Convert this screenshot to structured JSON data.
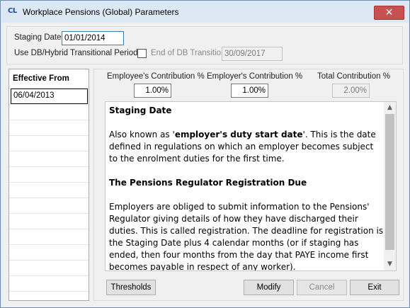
{
  "window": {
    "app_icon": "CL",
    "title": "Workplace Pensions (Global) Parameters",
    "close_glyph": "✕"
  },
  "staging": {
    "staging_date_label": "Staging Date",
    "staging_date_value": "01/01/2014",
    "transitional_label": "Use DB/Hybrid Transitional Period?",
    "transitional_checked": false,
    "end_db_label": "End of DB Transition",
    "end_db_value": "30/09/2017"
  },
  "effective": {
    "header": "Effective From",
    "selected_date": "06/04/2013"
  },
  "contributions": {
    "employee_label": "Employee's Contribution %",
    "employee_value": "1.00%",
    "employer_label": "Employer's Contribution %",
    "employer_value": "1.00%",
    "total_label": "Total Contribution %",
    "total_value": "2.00%"
  },
  "help": {
    "heading1": "Staging Date",
    "para1_prefix": "Also known as '",
    "para1_bold": "employer's duty start date",
    "para1_suffix": "'. This is the date defined in regulations on which an employer becomes subject to the enrolment duties for the first time.",
    "heading2": "The Pensions Regulator Registration Due",
    "para2": "Employers are obliged to submit information to the Pensions' Regulator giving details of how they have discharged their duties. This is called registration. The deadline for registration is the Staging Date plus 4 calendar months (or if staging has ended, then four months from the day that PAYE income first becomes payable in respect of any worker)."
  },
  "buttons": {
    "thresholds": "Thresholds",
    "modify": "Modify",
    "cancel": "Cancel",
    "exit": "Exit"
  },
  "icons": {
    "scroll_up": "▲",
    "scroll_down": "▼"
  }
}
